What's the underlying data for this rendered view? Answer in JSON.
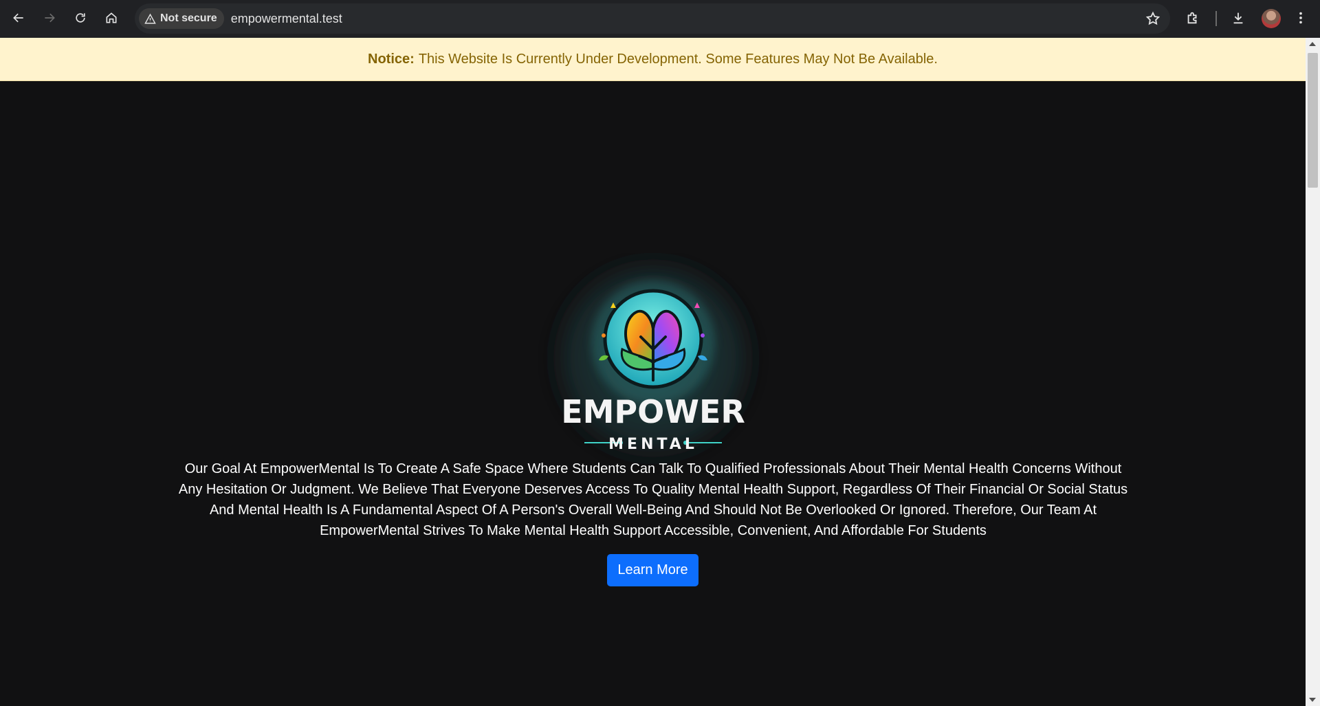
{
  "browser": {
    "security_label": "Not secure",
    "url": "empowermental.test"
  },
  "notice": {
    "label": "Notice:",
    "message": "This Website Is Currently Under Development. Some Features May Not Be Available."
  },
  "hero": {
    "logo_title": "EMPOWER",
    "logo_subtitle": "MENTAL",
    "mission": "Our Goal At EmpowerMental Is To Create A Safe Space Where Students Can Talk To Qualified Professionals About Their Mental Health Concerns Without Any Hesitation Or Judgment. We Believe That Everyone Deserves Access To Quality Mental Health Support, Regardless Of Their Financial Or Social Status And Mental Health Is A Fundamental Aspect Of A Person's Overall Well-Being And Should Not Be Overlooked Or Ignored. Therefore, Our Team At EmpowerMental Strives To Make Mental Health Support Accessible, Convenient, And Affordable For Students",
    "cta_label": "Learn More"
  },
  "colors": {
    "notice_bg": "#fff3cd",
    "notice_text": "#856404",
    "cta_bg": "#0d6efd",
    "page_bg": "#111112"
  }
}
